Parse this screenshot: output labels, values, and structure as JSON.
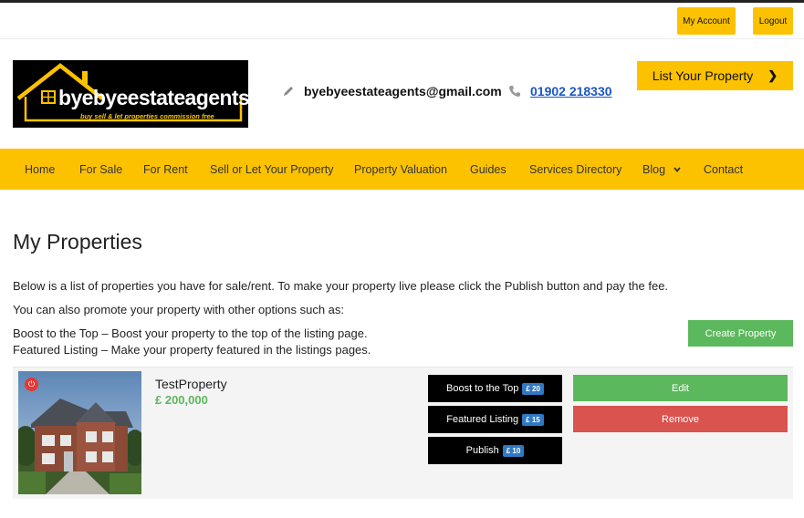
{
  "topbar": {
    "my_account": "My Account",
    "logout": "Logout"
  },
  "logo": {
    "name": "byebyeestateagents",
    "tagline": "buy  sell & let properties commission free"
  },
  "contact": {
    "email": "byebyeestateagents@gmail.com",
    "phone": "01902 218330"
  },
  "header": {
    "list_button": "List Your Property"
  },
  "nav": [
    {
      "label": "Home"
    },
    {
      "label": "For Sale"
    },
    {
      "label": "For Rent"
    },
    {
      "label": "Sell or Let Your Property"
    },
    {
      "label": "Property Valuation"
    },
    {
      "label": "Guides"
    },
    {
      "label": "Services Directory"
    },
    {
      "label": "Blog"
    },
    {
      "label": "Contact"
    }
  ],
  "page": {
    "title": "My Properties",
    "intro": "Below is a list of properties you have for sale/rent. To make your property live please click the Publish button and pay the fee.",
    "promote": "You can also promote your property with other options such as:",
    "boost_desc": "Boost to the Top – Boost your property to the top of the listing page.",
    "featured_desc": "Featured Listing – Make your property featured in the listings pages.",
    "create_button": "Create Property"
  },
  "property": {
    "name": "TestProperty",
    "price": "£ 200,000",
    "boost": {
      "label": "Boost to the Top",
      "price": "£ 20"
    },
    "featured": {
      "label": "Featured Listing",
      "price": "£ 15"
    },
    "publish": {
      "label": "Publish",
      "price": "£ 10"
    },
    "edit": "Edit",
    "remove": "Remove"
  },
  "colors": {
    "accent": "#fcc200",
    "success": "#5cb85c",
    "danger": "#d9534f",
    "badge": "#2f79c4",
    "link": "#1a56c8"
  }
}
